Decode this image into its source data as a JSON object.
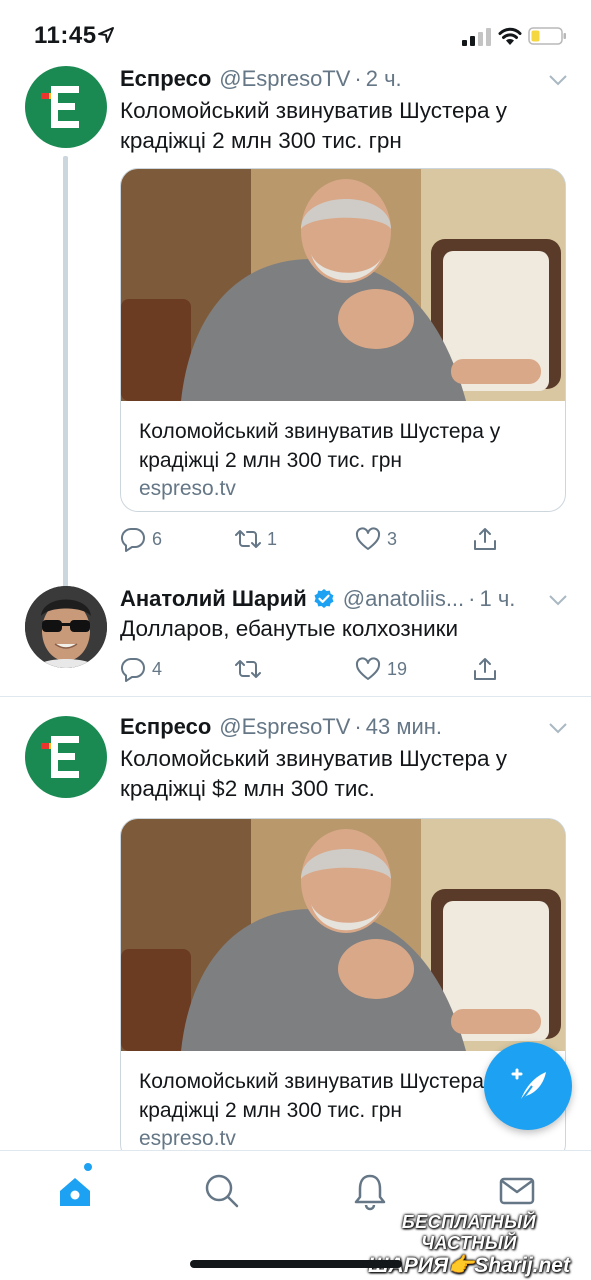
{
  "status_bar": {
    "time": "11:45"
  },
  "tweets": [
    {
      "name": "Еспресо",
      "handle": "@EspresoTV",
      "sep": "·",
      "time": "2 ч.",
      "text": "Коломойський звинуватив Шустера у крадіжці 2 млн 300 тис. грн",
      "card": {
        "title": "Коломойський звинуватив Шустера у крадіжці 2 млн 300 тис. грн",
        "domain": "espreso.tv"
      },
      "replies": "6",
      "retweets": "1",
      "likes": "3"
    },
    {
      "name": "Анатолий Шарий",
      "handle": "@anatoliis...",
      "sep": "·",
      "time": "1 ч.",
      "text": "Долларов, ебанутые колхозники",
      "replies": "4",
      "retweets": "",
      "likes": "19"
    },
    {
      "name": "Еспресо",
      "handle": "@EspresoTV",
      "sep": "·",
      "time": "43 мин.",
      "text": "Коломойський звинуватив Шустера у крадіжці $2 млн 300 тис.",
      "card": {
        "title": "Коломойський звинуватив Шустера у крадіжці 2 млн 300 тис. грн",
        "domain": "espreso.tv"
      }
    }
  ],
  "watermark": {
    "line1": "БЕСПЛАТНЫЙ ЧАСТНЫЙ",
    "line2": "ШАРИЯ👉Sharij.net"
  },
  "icons": [
    "location-arrow-icon",
    "signal-icon",
    "wifi-icon",
    "battery-icon",
    "caret-down-icon",
    "reply-icon",
    "retweet-icon",
    "like-icon",
    "share-icon",
    "verified-icon",
    "compose-icon",
    "home-icon",
    "search-icon",
    "notifications-icon",
    "messages-icon"
  ],
  "colors": {
    "accent": "#1da1f2",
    "brand_green": "#1b8a52",
    "muted": "#657786",
    "battery": "#f5d742"
  }
}
